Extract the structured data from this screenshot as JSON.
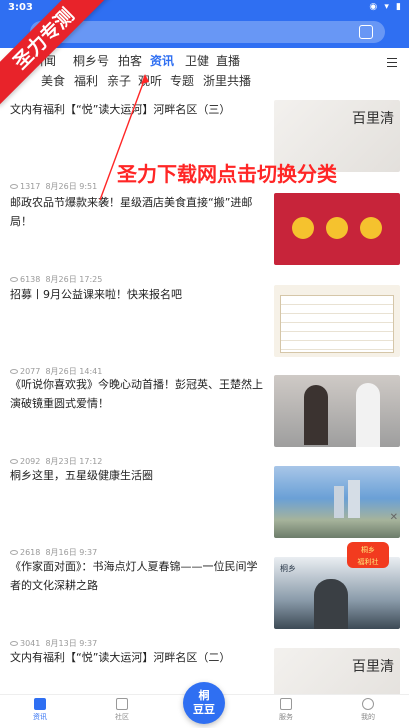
{
  "status": {
    "time": "3:03"
  },
  "banner": "圣力专测",
  "overlay": "圣力下载网点击切换分类",
  "tabs_row1": [
    "新闻",
    "桐乡号",
    "拍客",
    "资讯",
    "卫健",
    "直播"
  ],
  "tabs_row2": [
    "美食",
    "福利",
    "亲子",
    "观听",
    "专题",
    "浙里共播"
  ],
  "news": [
    {
      "title": "文内有福利【“悦”读大运河】河畔名区（三）",
      "views": "1317",
      "date": "8月26日 9:51"
    },
    {
      "title": "邮政农品节爆款来袭！星级酒店美食直接“搬”进邮局！",
      "views": "6138",
      "date": "8月26日 17:25"
    },
    {
      "title": "招募丨9月公益课来啦！快来报名吧",
      "views": "2077",
      "date": "8月26日 14:41"
    },
    {
      "title": "《听说你喜欢我》今晚心动首播！彭冠英、王楚然上演破镜重圆式爱情！",
      "views": "2092",
      "date": "8月23日 17:12"
    },
    {
      "title": "桐乡这里，五星级健康生活圈",
      "views": "2618",
      "date": "8月16日 9:37"
    },
    {
      "title": "《作家面对面》：书海点灯人夏春锦——一位民间学者的文化深耕之路",
      "views": "3041",
      "date": "8月13日 9:37"
    },
    {
      "title": "文内有福利【“悦”读大运河】河畔名区（二）",
      "views": "",
      "date": ""
    }
  ],
  "thumbs": {
    "t1": "百里清",
    "t6": "桐乡"
  },
  "promo": "桐乡\n福利社",
  "fab": "桐\n豆豆",
  "nav": [
    "资讯",
    "社区",
    "",
    "服务",
    "我的"
  ],
  "colors": {
    "brand": "#2f6ff2",
    "overlay": "#ff2626",
    "banner": "#e8232a"
  }
}
